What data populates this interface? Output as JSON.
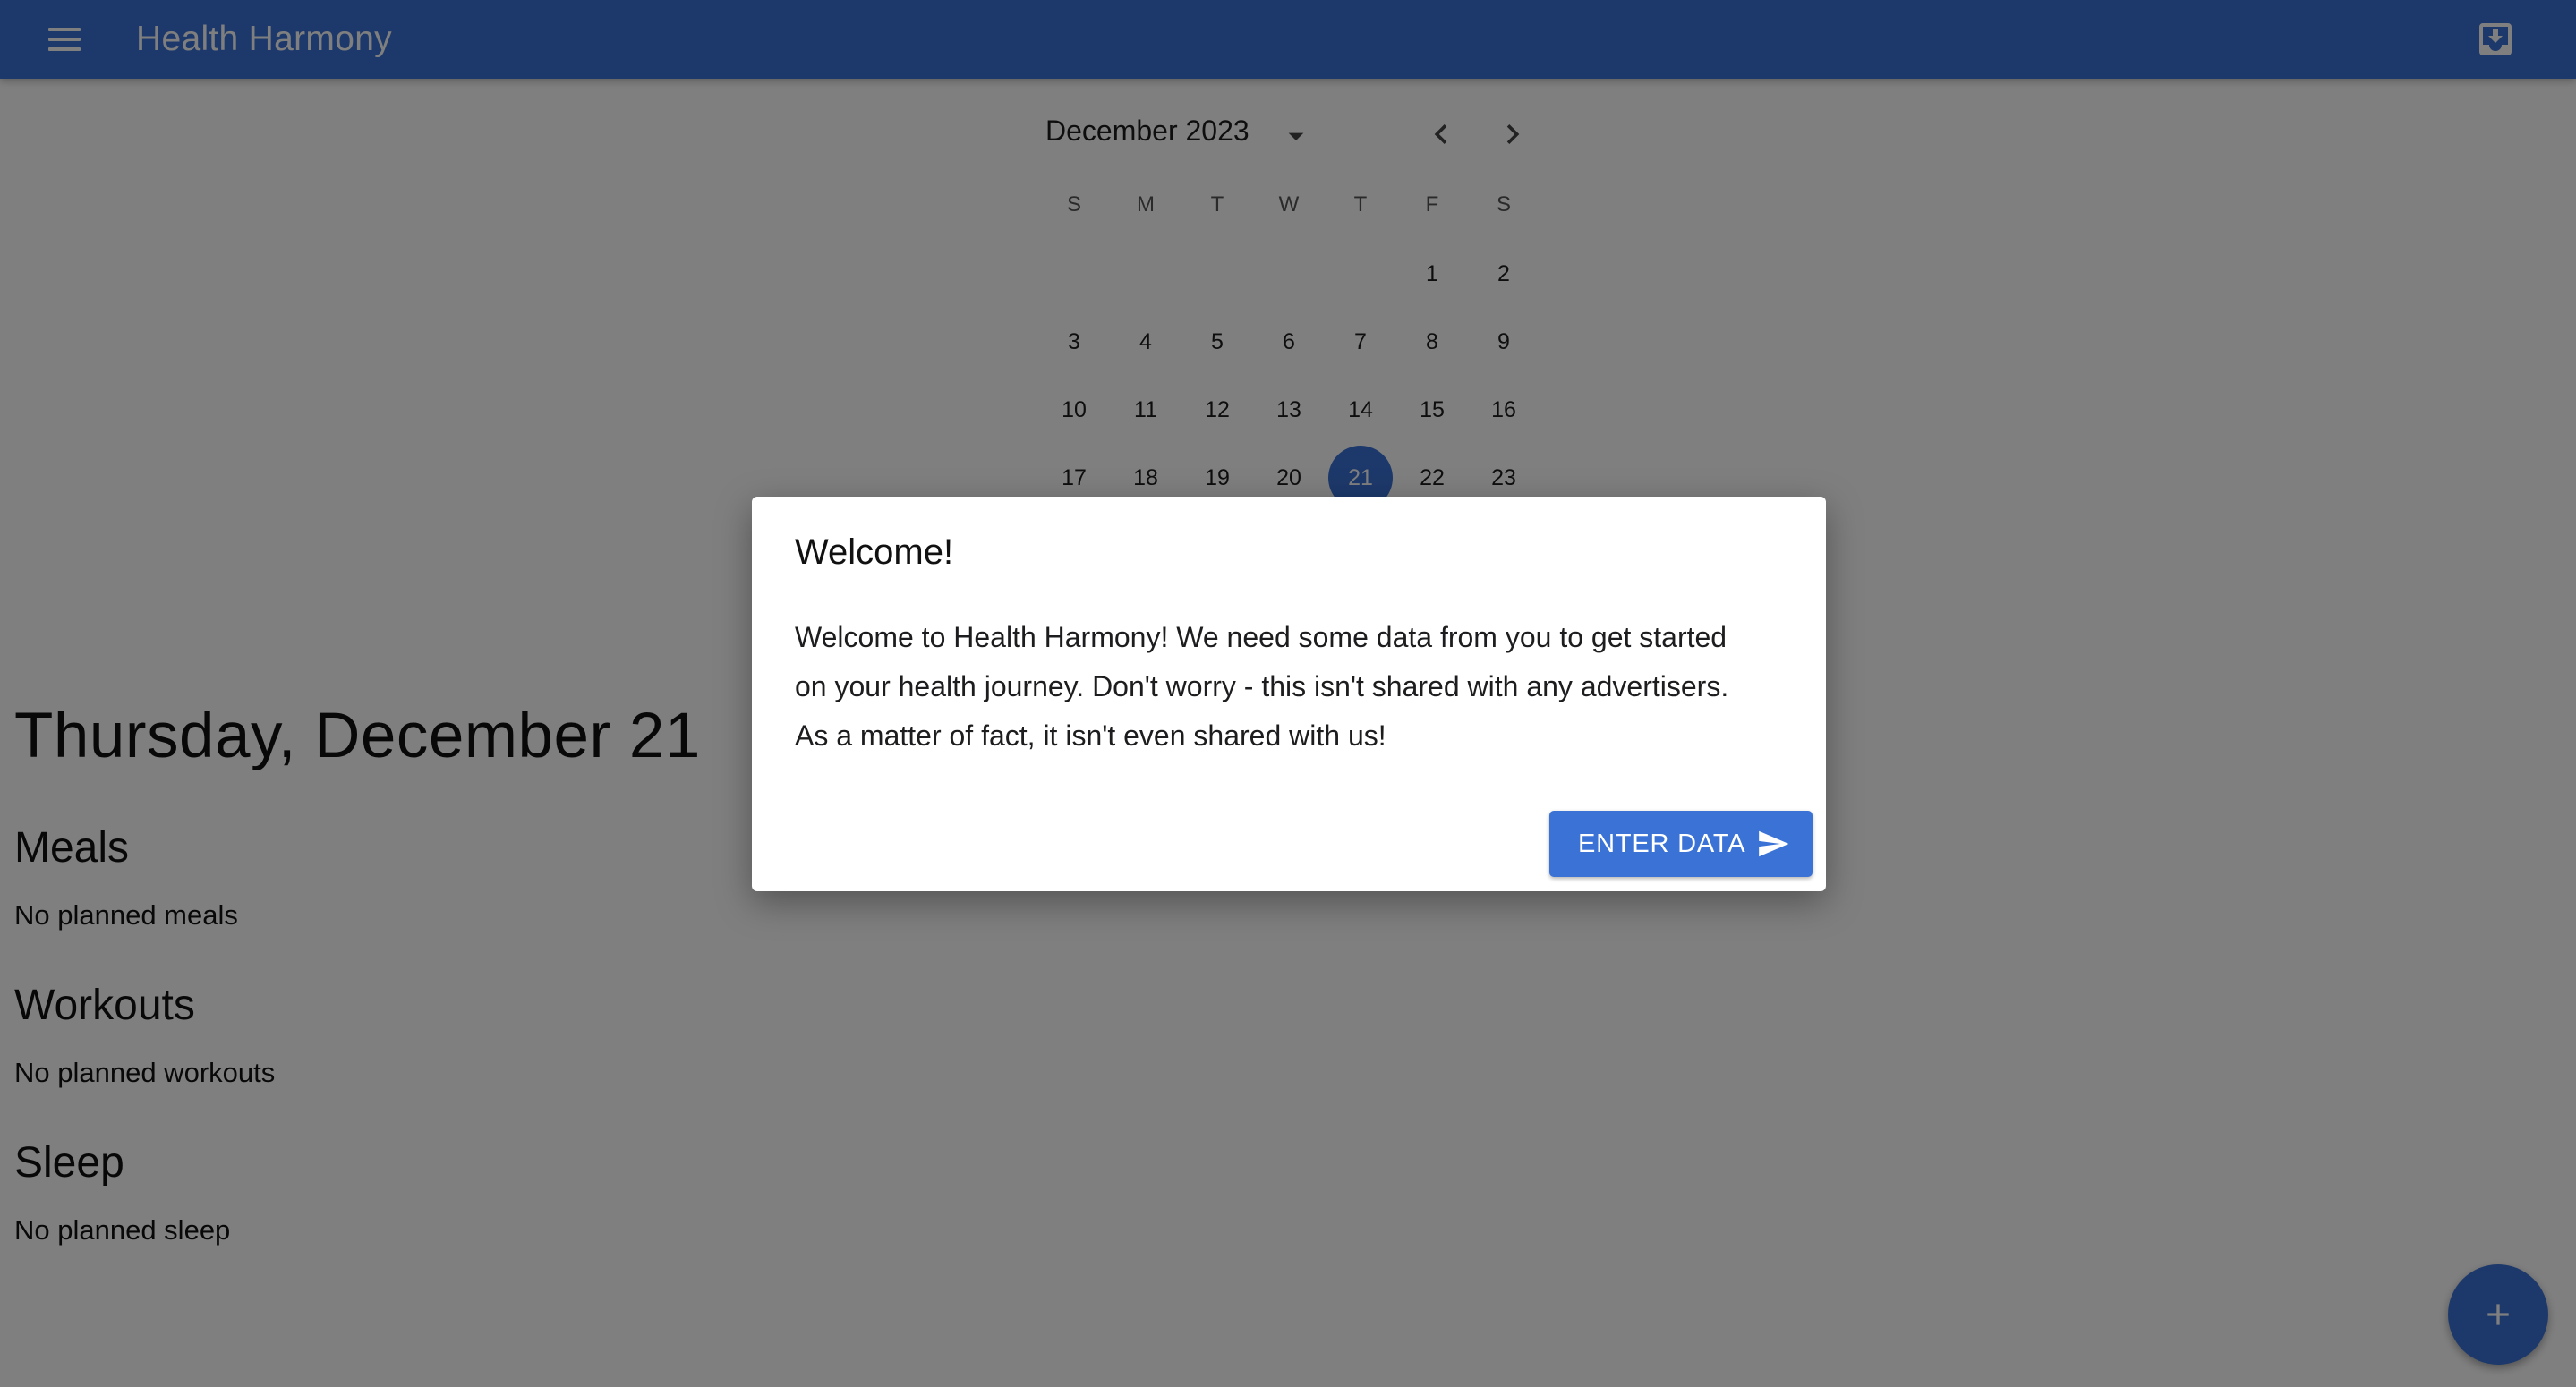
{
  "app": {
    "title": "Health Harmony",
    "accent_color": "#3a72d6",
    "menu_icon": "hamburger-menu-icon",
    "install_icon": "install-download-icon"
  },
  "calendar": {
    "month_label": "December 2023",
    "dropdown_icon": "caret-down-icon",
    "prev_icon": "chevron-left-icon",
    "next_icon": "chevron-right-icon",
    "weekdays": [
      "S",
      "M",
      "T",
      "W",
      "T",
      "F",
      "S"
    ],
    "weeks": [
      [
        "",
        "",
        "",
        "",
        "",
        "1",
        "2"
      ],
      [
        "3",
        "4",
        "5",
        "6",
        "7",
        "8",
        "9"
      ],
      [
        "10",
        "11",
        "12",
        "13",
        "14",
        "15",
        "16"
      ],
      [
        "17",
        "18",
        "19",
        "20",
        "21",
        "22",
        "23"
      ]
    ],
    "selected_day": "21"
  },
  "day": {
    "title": "Thursday, December 21",
    "sections": [
      {
        "title": "Meals",
        "empty_text": "No planned meals"
      },
      {
        "title": "Workouts",
        "empty_text": "No planned workouts"
      },
      {
        "title": "Sleep",
        "empty_text": "No planned sleep"
      }
    ]
  },
  "fab": {
    "icon": "plus-icon"
  },
  "dialog": {
    "title": "Welcome!",
    "body_lines": [
      "Welcome to Health Harmony! We need some data from you to get started",
      "on your health journey. Don't worry - this isn't shared with any advertisers.",
      "As a matter of fact, it isn't even shared with us!"
    ],
    "button_label": "ENTER DATA",
    "button_icon": "send-icon"
  }
}
